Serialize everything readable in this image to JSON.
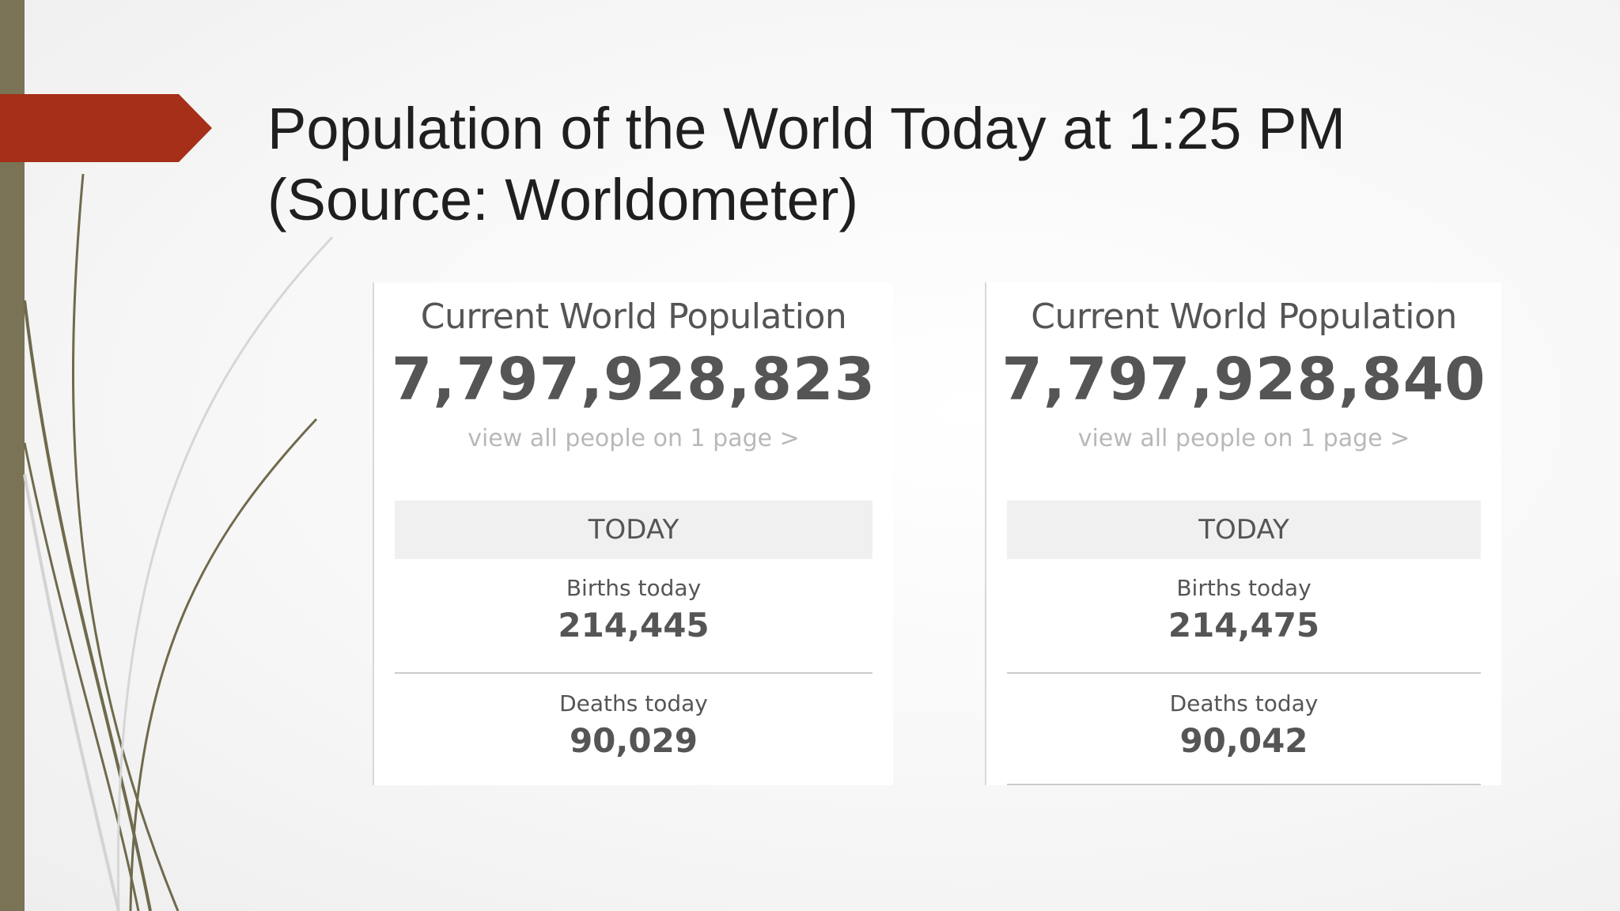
{
  "slide": {
    "title_line1": "Population of the World Today at 1:25 PM",
    "title_line2": "(Source: Worldometer)"
  },
  "cards": [
    {
      "heading": "Current World Population",
      "total": "7,797,928,823",
      "link": "view all people on 1 page >",
      "section": "TODAY",
      "births_label": "Births today",
      "births_value": "214,445",
      "deaths_label": "Deaths today",
      "deaths_value": "90,029"
    },
    {
      "heading": "Current World Population",
      "total": "7,797,928,840",
      "link": "view all people on 1 page >",
      "section": "TODAY",
      "births_label": "Births today",
      "births_value": "214,475",
      "deaths_label": "Deaths today",
      "deaths_value": "90,042"
    }
  ],
  "colors": {
    "accent_bar": "#7a7355",
    "title_arrow": "#a52f19",
    "text_gray": "#555555"
  }
}
